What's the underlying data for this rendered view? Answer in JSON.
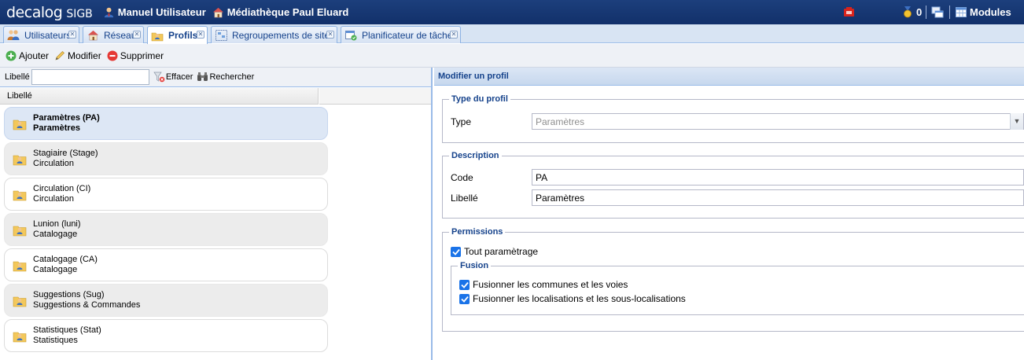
{
  "app": {
    "brand": "decalog",
    "product": "SIGB",
    "user": "Manuel Utilisateur",
    "library": "Médiathèque Paul Eluard",
    "notification_count": "0",
    "modules_label": "Modules"
  },
  "tabs": [
    {
      "label": "Utilisateurs",
      "icon": "users-icon"
    },
    {
      "label": "Réseau",
      "icon": "house-icon"
    },
    {
      "label": "Profils",
      "icon": "folder-user-icon",
      "active": true
    },
    {
      "label": "Regroupements de sites",
      "icon": "group-sites-icon"
    },
    {
      "label": "Planificateur de tâches",
      "icon": "scheduler-icon"
    }
  ],
  "toolbar": {
    "add_label": "Ajouter",
    "edit_label": "Modifier",
    "delete_label": "Supprimer"
  },
  "search": {
    "label": "Libellé",
    "value": "",
    "clear_label": "Effacer",
    "search_label": "Rechercher"
  },
  "list": {
    "column_header": "Libellé",
    "rows": [
      {
        "title": "Paramètres (PA)",
        "subtitle": "Paramètres",
        "state": "selected"
      },
      {
        "title": "Stagiaire (Stage)",
        "subtitle": "Circulation",
        "state": "grey"
      },
      {
        "title": "Circulation (CI)",
        "subtitle": "Circulation",
        "state": "white"
      },
      {
        "title": "Lunion (luni)",
        "subtitle": "Catalogage",
        "state": "grey"
      },
      {
        "title": "Catalogage (CA)",
        "subtitle": "Catalogage",
        "state": "white"
      },
      {
        "title": "Suggestions (Sug)",
        "subtitle": "Suggestions & Commandes",
        "state": "grey"
      },
      {
        "title": "Statistiques (Stat)",
        "subtitle": "Statistiques",
        "state": "white"
      }
    ]
  },
  "form": {
    "header": "Modifier un profil",
    "type_section": {
      "legend": "Type du profil",
      "type_label": "Type",
      "type_value": "Paramètres"
    },
    "description_section": {
      "legend": "Description",
      "code_label": "Code",
      "code_value": "PA",
      "libelle_label": "Libellé",
      "libelle_value": "Paramètres"
    },
    "permissions_section": {
      "legend": "Permissions",
      "all_params_label": "Tout paramètrage",
      "all_params_checked": true,
      "fusion": {
        "legend": "Fusion",
        "merge_communes_label": "Fusionner les communes et les voies",
        "merge_communes_checked": true,
        "merge_locations_label": "Fusionner les localisations et les sous-localisations",
        "merge_locations_checked": true
      }
    }
  },
  "colors": {
    "topbar": "#1c3f7c",
    "panel_title": "#15428b",
    "checkbox": "#1a73e8",
    "selected_row": "#dde7f5"
  }
}
